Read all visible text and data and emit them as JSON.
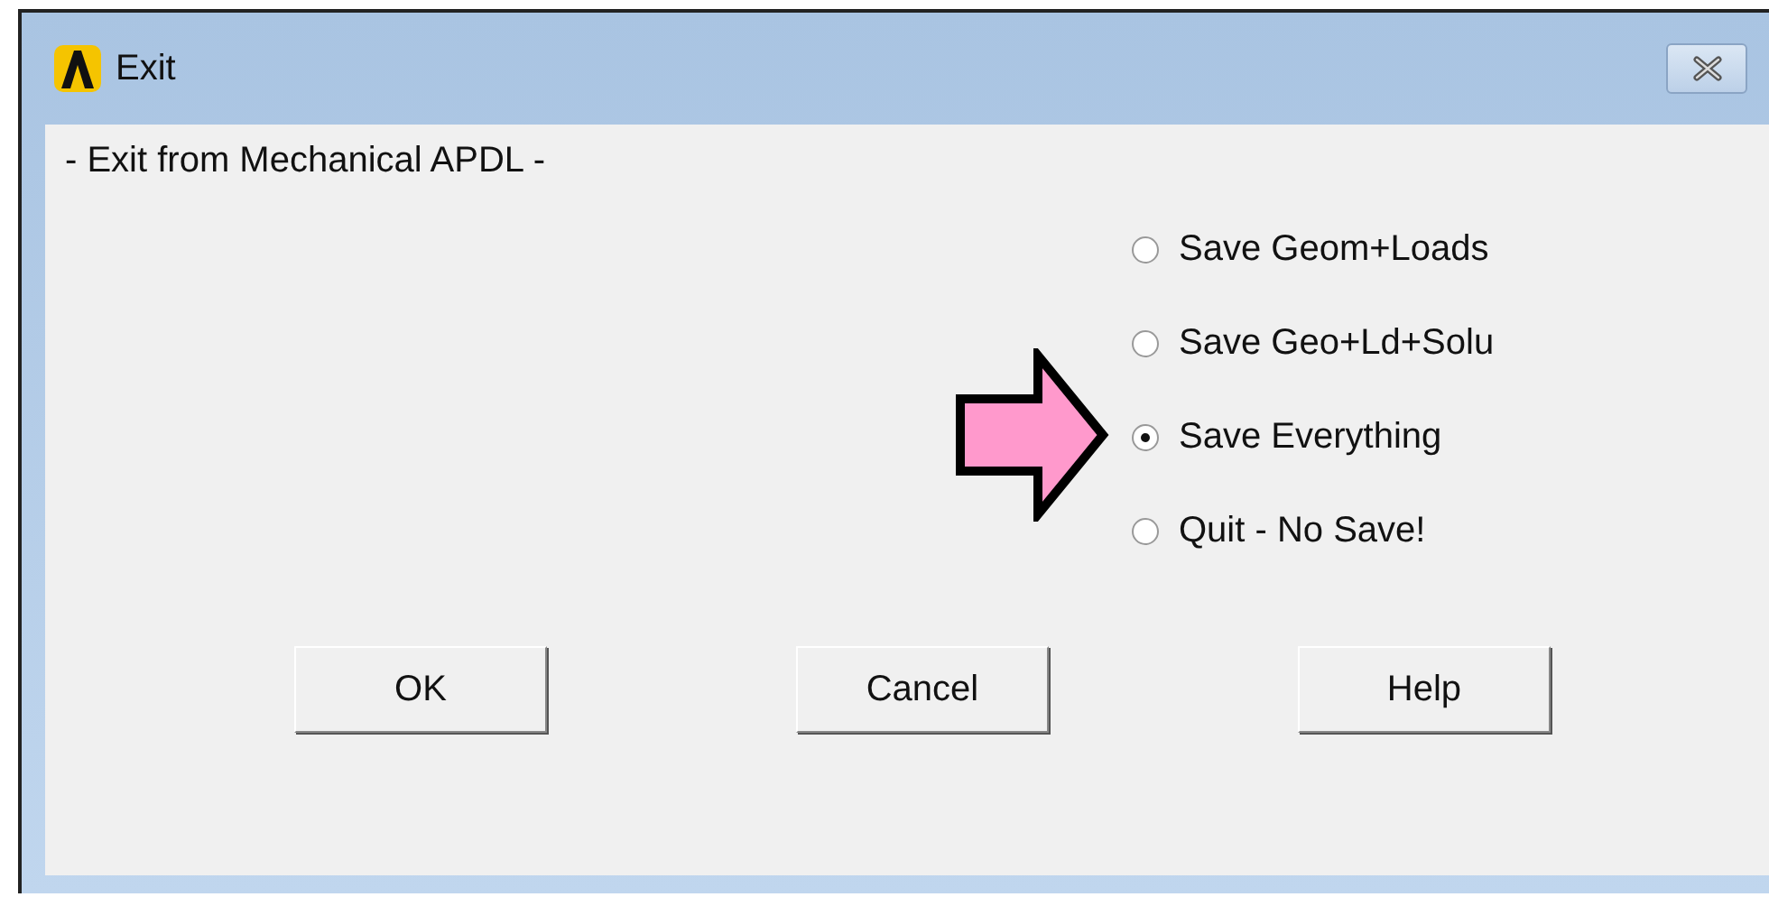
{
  "window": {
    "title": "Exit"
  },
  "heading": "- Exit from Mechanical APDL -",
  "options": [
    {
      "label": "Save Geom+Loads",
      "selected": false
    },
    {
      "label": "Save Geo+Ld+Solu",
      "selected": false
    },
    {
      "label": "Save Everything",
      "selected": true
    },
    {
      "label": "Quit - No Save!",
      "selected": false
    }
  ],
  "buttons": [
    "OK",
    "Cancel",
    "Help"
  ]
}
